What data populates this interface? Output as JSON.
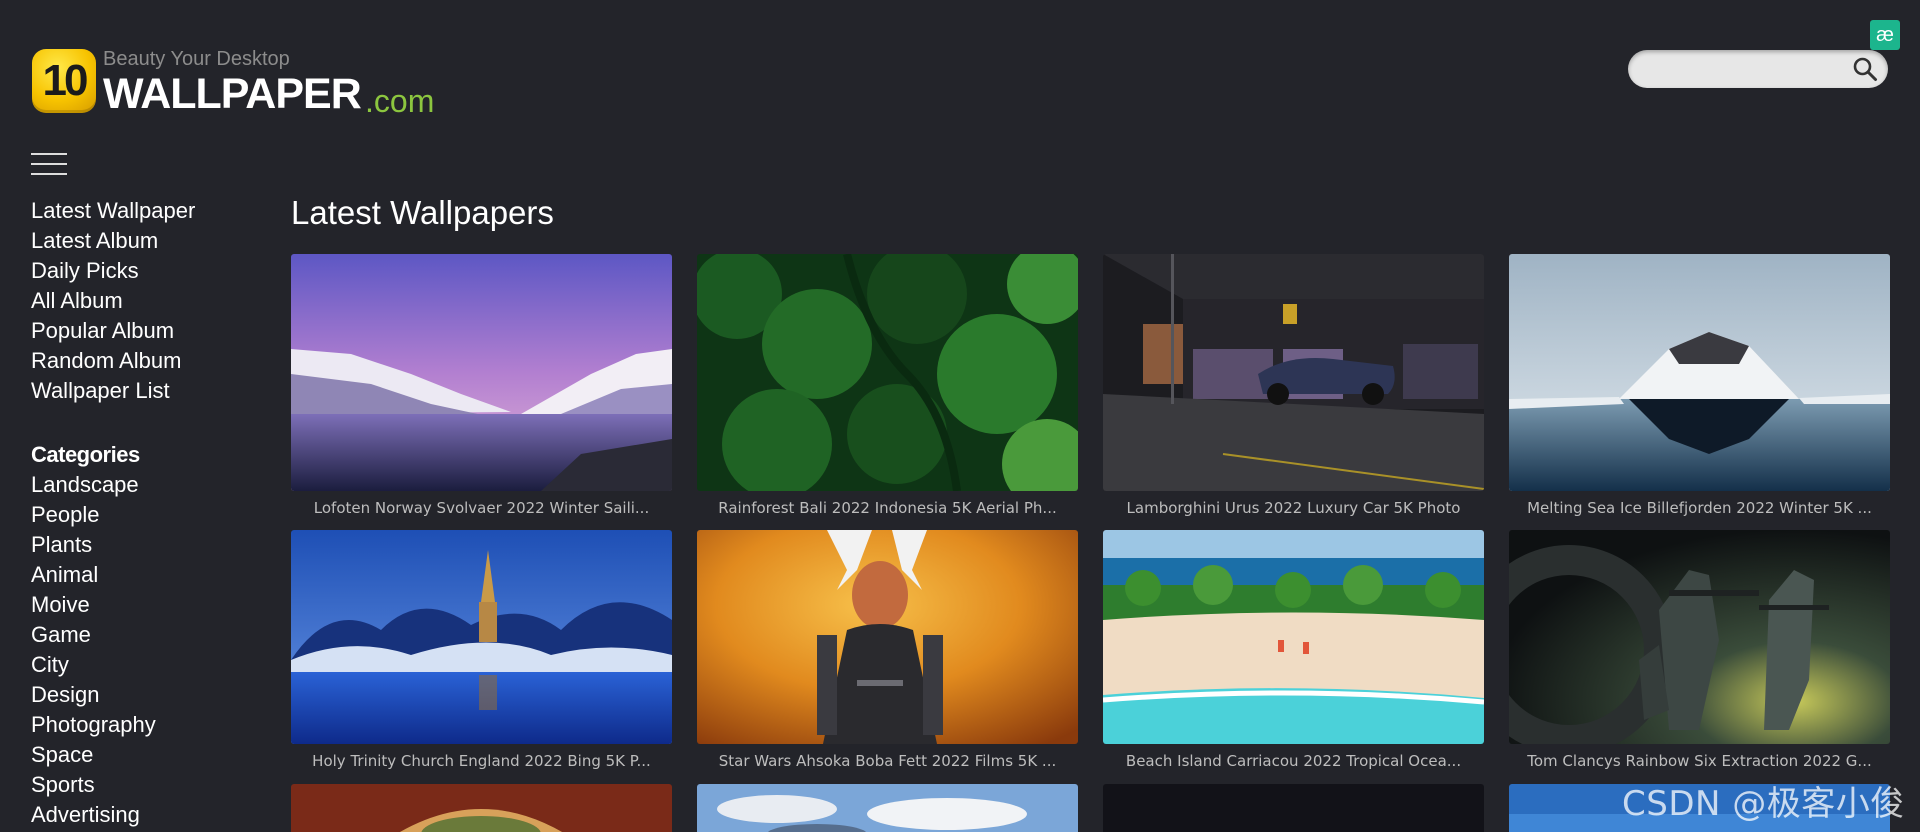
{
  "logo": {
    "badge": "10",
    "tagline": "Beauty Your Desktop",
    "brand": "WALLPAPER",
    "domain": ".com"
  },
  "corner_badge": "æ",
  "search": {
    "placeholder": "",
    "value": ""
  },
  "nav": [
    "Latest Wallpaper",
    "Latest Album",
    "Daily Picks",
    "All Album",
    "Popular Album",
    "Random Album",
    "Wallpaper List"
  ],
  "categories_heading": "Categories",
  "categories": [
    "Landscape",
    "People",
    "Plants",
    "Animal",
    "Moive",
    "Game",
    "City",
    "Design",
    "Photography",
    "Space",
    "Sports",
    "Advertising"
  ],
  "main_title": "Latest Wallpapers",
  "wallpapers": [
    {
      "caption": "Lofoten Norway Svolvaer 2022 Winter Saili..."
    },
    {
      "caption": "Rainforest Bali 2022 Indonesia 5K Aerial Ph..."
    },
    {
      "caption": "Lamborghini Urus 2022 Luxury Car 5K Photo"
    },
    {
      "caption": "Melting Sea Ice Billefjorden 2022 Winter 5K ..."
    },
    {
      "caption": "Holy Trinity Church England 2022 Bing 5K P..."
    },
    {
      "caption": "Star Wars Ahsoka Boba Fett 2022 Films 5K ..."
    },
    {
      "caption": "Beach Island Carriacou 2022 Tropical Ocea..."
    },
    {
      "caption": "Tom Clancys Rainbow Six Extraction 2022 G..."
    }
  ],
  "watermark": "CSDN @极客小俊",
  "colors": {
    "background": "#23242a",
    "accent_green": "#8cc63f",
    "badge_yellow": "#f7c300"
  }
}
